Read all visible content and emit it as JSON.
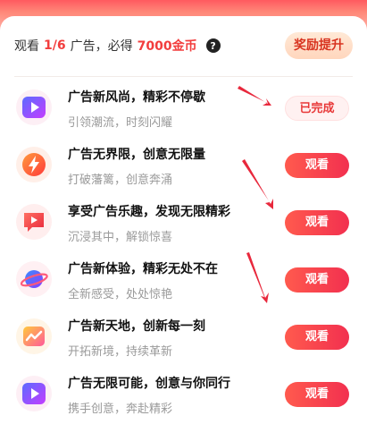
{
  "header": {
    "watch_label": "观看",
    "progress": "1/6",
    "ad_reward_prefix": "广告，必得",
    "coins": "7000金币",
    "help_icon": "?",
    "reward_button": "奖励提升"
  },
  "tasks": [
    {
      "icon": "play-icon",
      "title": "广告新风尚，精彩不停歇",
      "subtitle": "引领潮流，时刻闪耀",
      "button": "已完成",
      "status": "completed"
    },
    {
      "icon": "lightning-icon",
      "title": "广告无界限，创意无限量",
      "subtitle": "打破藩篱，创意奔涌",
      "button": "观看",
      "status": "pending"
    },
    {
      "icon": "chat-play-icon",
      "title": "享受广告乐趣，发现无限精彩",
      "subtitle": "沉浸其中，解锁惊喜",
      "button": "观看",
      "status": "pending"
    },
    {
      "icon": "planet-icon",
      "title": "广告新体验，精彩无处不在",
      "subtitle": "全新感受，处处惊艳",
      "button": "观看",
      "status": "pending"
    },
    {
      "icon": "chart-icon",
      "title": "广告新天地，创新每一刻",
      "subtitle": "开拓新境，持续革新",
      "button": "观看",
      "status": "pending"
    },
    {
      "icon": "play-icon",
      "title": "广告无限可能，创意与你同行",
      "subtitle": "携手创意，奔赴精彩",
      "button": "观看",
      "status": "pending"
    }
  ],
  "colors": {
    "accent": "#f23d3d",
    "button_gradient_start": "#ff5a4e",
    "button_gradient_end": "#f2304f",
    "annotation_arrow": "#e8283c"
  }
}
